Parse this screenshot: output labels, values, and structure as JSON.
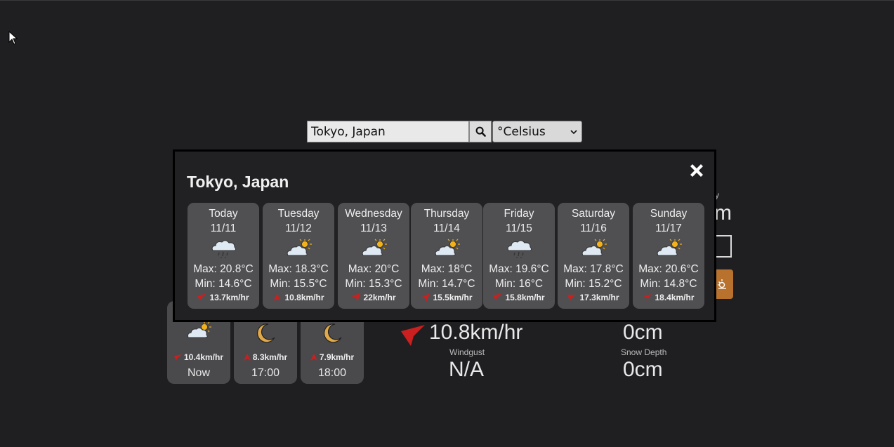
{
  "search": {
    "value": "Tokyo, Japan",
    "unit_selected": "°Celsius"
  },
  "background": {
    "partial_label": "y",
    "partial_value": "m",
    "hourly": [
      {
        "wind": "10.4km/hr",
        "time": "Now",
        "icon": "partly-cloudy-icon"
      },
      {
        "wind": "8.3km/hr",
        "time": "17:00",
        "icon": "moon-icon"
      },
      {
        "wind": "7.9km/hr",
        "time": "18:00",
        "icon": "moon-icon"
      }
    ],
    "wind_speed": "10.8km/hr",
    "windgust_label": "Windgust",
    "windgust_value": "N/A",
    "snow_value": "0cm",
    "snow_depth_label": "Snow Depth",
    "snow_depth_value": "0cm"
  },
  "modal": {
    "title": "Tokyo, Japan",
    "days": [
      {
        "name": "Today",
        "date": "11/11",
        "icon": "rain-icon",
        "max": "Max: 20.8°C",
        "min": "Min: 14.6°C",
        "wind": "13.7km/hr"
      },
      {
        "name": "Tuesday",
        "date": "11/12",
        "icon": "partly-cloudy-icon",
        "max": "Max: 18.3°C",
        "min": "Min: 15.5°C",
        "wind": "10.8km/hr"
      },
      {
        "name": "Wednesday",
        "date": "11/13",
        "icon": "partly-cloudy-icon",
        "max": "Max: 20°C",
        "min": "Min: 15.3°C",
        "wind": "22km/hr"
      },
      {
        "name": "Thursday",
        "date": "11/14",
        "icon": "partly-cloudy-icon",
        "max": "Max: 18°C",
        "min": "Min: 14.7°C",
        "wind": "15.5km/hr"
      },
      {
        "name": "Friday",
        "date": "11/15",
        "icon": "rain-icon",
        "max": "Max: 19.6°C",
        "min": "Min: 16°C",
        "wind": "15.8km/hr"
      },
      {
        "name": "Saturday",
        "date": "11/16",
        "icon": "partly-cloudy-icon",
        "max": "Max: 17.8°C",
        "min": "Min: 15.2°C",
        "wind": "17.3km/hr"
      },
      {
        "name": "Sunday",
        "date": "11/17",
        "icon": "partly-cloudy-icon",
        "max": "Max: 20.6°C",
        "min": "Min: 14.8°C",
        "wind": "18.4km/hr"
      }
    ]
  },
  "colors": {
    "accent_wind": "#cc1f1f",
    "moon": "#e0a94a",
    "sun": "#f3b21b",
    "card_bg": "#505053"
  }
}
